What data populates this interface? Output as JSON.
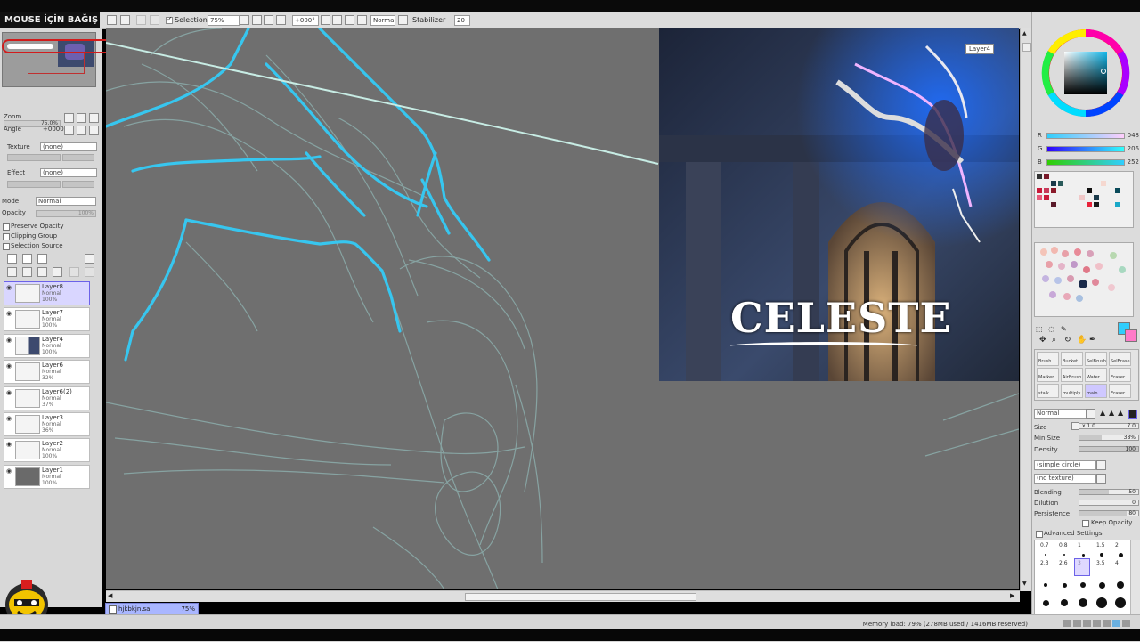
{
  "toolbar": {
    "selection_label": "Selection",
    "zoom_value": "75%",
    "angle_value": "+000°",
    "blend_value": "Normal",
    "stabilizer_label": "Stabilizer",
    "stabilizer_value": "20"
  },
  "overlay": {
    "banner": "MOUSE İÇİN BAĞIŞ"
  },
  "left_panel": {
    "zoom_label": "Zoom",
    "zoom_value": "75.0%",
    "angle_label": "Angle",
    "angle_value": "+0000",
    "texture_label": "Texture",
    "texture_value": "(none)",
    "effect_label": "Effect",
    "effect_value": "(none)",
    "mode_label": "Mode",
    "mode_value": "Normal",
    "opacity_label": "Opacity",
    "opacity_value": "100%",
    "preserve_opacity": "Preserve Opacity",
    "clipping_group": "Clipping Group",
    "selection_source": "Selection Source",
    "layers": [
      {
        "name": "Layer8",
        "mode": "Normal",
        "opacity": "100%",
        "selected": true
      },
      {
        "name": "Layer7",
        "mode": "Normal",
        "opacity": "100%"
      },
      {
        "name": "Layer4",
        "mode": "Normal",
        "opacity": "100%"
      },
      {
        "name": "Layer6",
        "mode": "Normal",
        "opacity": "32%"
      },
      {
        "name": "Layer6(2)",
        "mode": "Normal",
        "opacity": "37%"
      },
      {
        "name": "Layer3",
        "mode": "Normal",
        "opacity": "36%"
      },
      {
        "name": "Layer2",
        "mode": "Normal",
        "opacity": "100%"
      },
      {
        "name": "Layer1",
        "mode": "Normal",
        "opacity": "100%"
      }
    ]
  },
  "canvas": {
    "image_title": "CELESTE",
    "layer_tooltip": "Layer4"
  },
  "right_panel": {
    "r_label": "R",
    "r_value": "048",
    "g_label": "G",
    "g_value": "206",
    "b_label": "B",
    "b_value": "252",
    "tools": [
      "Brush",
      "Bucket",
      "SelBrush",
      "SelErase",
      "Marker",
      "AirBrush",
      "Water",
      "Eraser"
    ],
    "tools_row2": [
      "stalk",
      "multiply",
      "main",
      "Eraser"
    ],
    "brush_mode": "Normal",
    "size_label": "Size",
    "size_mult": "x 1.0",
    "size_value": "7.0",
    "min_size_label": "Min Size",
    "min_size_value": "38%",
    "density_label": "Density",
    "density_value": "100",
    "shape_value": "(simple circle)",
    "texture_value": "(no texture)",
    "blending_label": "Blending",
    "blending_value": "50",
    "dilution_label": "Dilution",
    "dilution_value": "0",
    "persistence_label": "Persistence",
    "persistence_value": "80",
    "keep_opacity": "Keep Opacity",
    "advanced_settings": "Advanced Settings",
    "sizes_row1": [
      "0.7",
      "0.8",
      "1",
      "1.5",
      "2"
    ],
    "sizes_row2": [
      "2.3",
      "2.6",
      "3",
      "3.5",
      "4"
    ]
  },
  "status": {
    "file_name": "hjkbkjn.sai",
    "file_zoom": "75%",
    "memory": "Memory load: 79% (278MB used / 1416MB reserved)"
  },
  "colors": {
    "accent_cyan": "#30CEFC",
    "selected_layer": "#D9D6FF",
    "canvas_bg": "#6F6F6F"
  }
}
